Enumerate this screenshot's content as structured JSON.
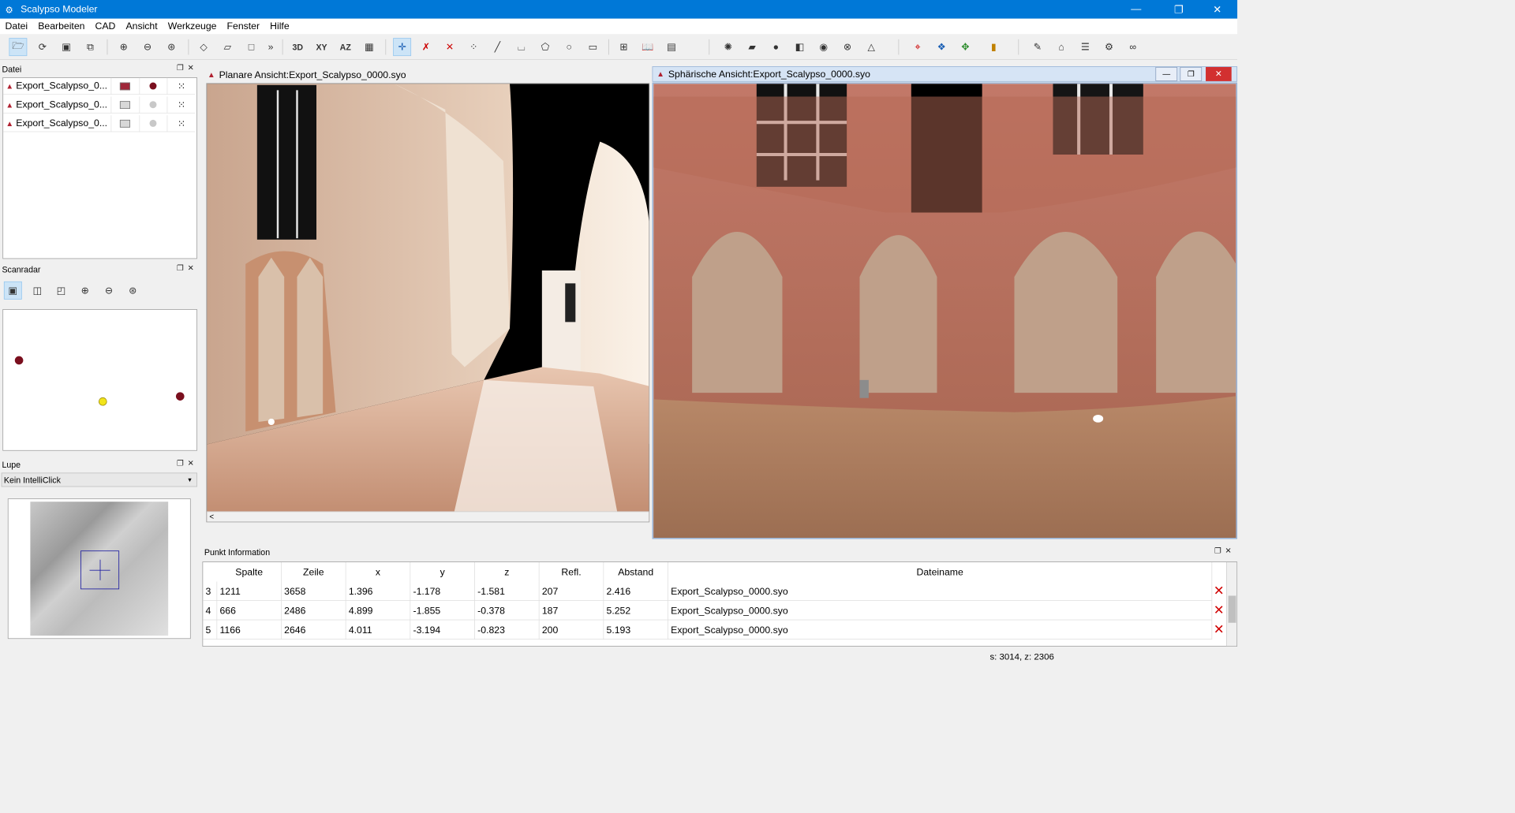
{
  "window": {
    "title": "Scalypso Modeler",
    "minimize": "—",
    "maximize": "❐",
    "close": "✕"
  },
  "menu": [
    "Datei",
    "Bearbeiten",
    "CAD",
    "Ansicht",
    "Werkzeuge",
    "Fenster",
    "Hilfe"
  ],
  "toolbar": {
    "text_buttons": {
      "b3d": "3D",
      "bxy": "XY",
      "baz": "AZ"
    },
    "overflow": "»"
  },
  "datei_panel": {
    "title": "Datei",
    "files": [
      {
        "name": "Export_Scalypso_0...",
        "color": "#a0283a",
        "dot": "#7a0f1e"
      },
      {
        "name": "Export_Scalypso_0...",
        "color": "#d8d8d8",
        "dot": "#c8c8c8"
      },
      {
        "name": "Export_Scalypso_0...",
        "color": "#d8d8d8",
        "dot": "#c8c8c8"
      }
    ]
  },
  "scanradar": {
    "title": "Scanradar"
  },
  "lupe": {
    "title": "Lupe",
    "mode": "Kein IntelliClick"
  },
  "planar_view": {
    "title": "Planare Ansicht:Export_Scalypso_0000.syo",
    "scroll_left": "<"
  },
  "spherical_view": {
    "title": "Sphärische Ansicht:Export_Scalypso_0000.syo"
  },
  "punkt_info": {
    "title": "Punkt Information",
    "columns": [
      "Spalte",
      "Zeile",
      "x",
      "y",
      "z",
      "Refl.",
      "Abstand",
      "Dateiname"
    ],
    "rows": [
      {
        "idx": "3",
        "spalte": "1211",
        "zeile": "3658",
        "x": "1.396",
        "y": "-1.178",
        "z": "-1.581",
        "refl": "207",
        "abstand": "2.416",
        "datei": "Export_Scalypso_0000.syo"
      },
      {
        "idx": "4",
        "spalte": "666",
        "zeile": "2486",
        "x": "4.899",
        "y": "-1.855",
        "z": "-0.378",
        "refl": "187",
        "abstand": "5.252",
        "datei": "Export_Scalypso_0000.syo"
      },
      {
        "idx": "5",
        "spalte": "1166",
        "zeile": "2646",
        "x": "4.011",
        "y": "-3.194",
        "z": "-0.823",
        "refl": "200",
        "abstand": "5.193",
        "datei": "Export_Scalypso_0000.syo"
      }
    ],
    "delete_symbol": "✕"
  },
  "status": {
    "text": "s: 3014, z: 2306"
  }
}
